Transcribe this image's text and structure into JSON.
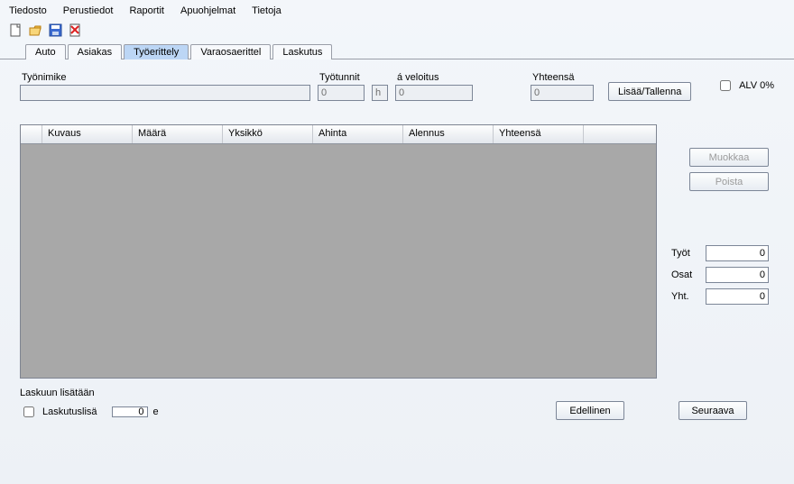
{
  "menubar": [
    "Tiedosto",
    "Perustiedot",
    "Raportit",
    "Apuohjelmat",
    "Tietoja"
  ],
  "toolbar_icons": [
    "new-icon",
    "open-icon",
    "save-icon",
    "delete-icon"
  ],
  "tabs": [
    {
      "label": "Auto",
      "active": false
    },
    {
      "label": "Asiakas",
      "active": false
    },
    {
      "label": "Työerittely",
      "active": true
    },
    {
      "label": "Varaosaerittel",
      "active": false
    },
    {
      "label": "Laskutus",
      "active": false
    }
  ],
  "fields": {
    "tyonimike_label": "Työnimike",
    "tyonimike_value": "",
    "tyotunnit_label": "Työtunnit",
    "tyotunnit_value": "0",
    "tyotunnit_unit": "h",
    "aveloitus_label": "á veloitus",
    "aveloitus_value": "0",
    "yhteensa_label": "Yhteensä",
    "yhteensa_value": "0",
    "add_btn": "Lisää/Tallenna",
    "alv_label": "ALV 0%"
  },
  "grid_columns": [
    "Kuvaus",
    "Määrä",
    "Yksikkö",
    "Ahinta",
    "Alennus",
    "Yhteensä"
  ],
  "side": {
    "edit_btn": "Muokkaa",
    "delete_btn": "Poista"
  },
  "totals": {
    "tyot_label": "Työt",
    "tyot_value": "0",
    "osat_label": "Osat",
    "osat_value": "0",
    "yht_label": "Yht.",
    "yht_value": "0"
  },
  "footer": {
    "section_title": "Laskuun lisätään",
    "laskutuslisa_label": "Laskutuslisä",
    "laskutuslisa_value": "0",
    "laskutuslisa_unit": "e",
    "prev_btn": "Edellinen",
    "next_btn": "Seuraava"
  }
}
